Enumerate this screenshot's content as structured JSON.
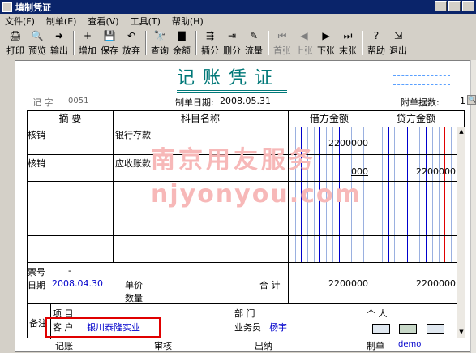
{
  "window": {
    "title": "填制凭证"
  },
  "menu": [
    {
      "label": "文件(F)"
    },
    {
      "label": "制单(E)"
    },
    {
      "label": "查看(V)"
    },
    {
      "label": "工具(T)"
    },
    {
      "label": "帮助(H)"
    }
  ],
  "toolbar": [
    {
      "label": "打印",
      "icon": "printer-icon",
      "glyph": "🖨",
      "enabled": true
    },
    {
      "label": "预览",
      "icon": "preview-icon",
      "glyph": "🔍",
      "enabled": true
    },
    {
      "label": "输出",
      "icon": "export-icon",
      "glyph": "➜",
      "enabled": true
    },
    {
      "label": "增加",
      "icon": "add-icon",
      "glyph": "+",
      "enabled": true
    },
    {
      "label": "保存",
      "icon": "save-icon",
      "glyph": "💾",
      "enabled": true
    },
    {
      "label": "放弃",
      "icon": "undo-icon",
      "glyph": "↶",
      "enabled": true
    },
    {
      "label": "查询",
      "icon": "binoculars-icon",
      "glyph": "🔭",
      "enabled": true
    },
    {
      "label": "余额",
      "icon": "balance-chart-icon",
      "glyph": "▇",
      "enabled": true
    },
    {
      "label": "插分",
      "icon": "insert-row-icon",
      "glyph": "⇶",
      "enabled": true
    },
    {
      "label": "删分",
      "icon": "delete-row-icon",
      "glyph": "⇥",
      "enabled": true
    },
    {
      "label": "流量",
      "icon": "cashflow-icon",
      "glyph": "✎",
      "enabled": true
    },
    {
      "label": "首张",
      "icon": "first-record-icon",
      "glyph": "⏮",
      "enabled": false
    },
    {
      "label": "上张",
      "icon": "previous-record-icon",
      "glyph": "◀",
      "enabled": false
    },
    {
      "label": "下张",
      "icon": "next-record-icon",
      "glyph": "▶",
      "enabled": true
    },
    {
      "label": "末张",
      "icon": "last-record-icon",
      "glyph": "⏭",
      "enabled": true
    },
    {
      "label": "帮助",
      "icon": "help-icon",
      "glyph": "?",
      "enabled": true
    },
    {
      "label": "退出",
      "icon": "exit-icon",
      "glyph": "⇲",
      "enabled": true
    }
  ],
  "voucher": {
    "title": "记账凭证",
    "type_label": "记 字",
    "number": "0051",
    "date_label": "制单日期:",
    "date": "2008.05.31",
    "attachments_label": "附单据数:",
    "attachments_value": "1"
  },
  "grid": {
    "headers": {
      "summary": "摘 要",
      "account": "科目名称",
      "debit": "借方金额",
      "credit": "贷方金额"
    },
    "rows": [
      {
        "summary": "核销",
        "account": "银行存款",
        "debit": "2200000",
        "credit": ""
      },
      {
        "summary": "核销",
        "account": "应收账款",
        "debit": "000",
        "credit": "2200000"
      },
      {
        "summary": "",
        "account": "",
        "debit": "",
        "credit": ""
      },
      {
        "summary": "",
        "account": "",
        "debit": "",
        "credit": ""
      },
      {
        "summary": "",
        "account": "",
        "debit": "",
        "credit": ""
      }
    ],
    "ticket_label": "票号",
    "ticket_value": "-",
    "date_label": "日期",
    "date_value": "2008.04.30",
    "price_label": "单价",
    "qty_label": "数量",
    "total_label": "合 计",
    "total_debit": "2200000",
    "total_credit": "2200000"
  },
  "notes": {
    "label": "备注",
    "project_label": "项 目",
    "customer_label": "客 户",
    "customer_value": "银川泰隆实业",
    "department_label": "部 门",
    "salesperson_label": "业务员",
    "salesperson_value": "杨宇",
    "person_label": "个 人"
  },
  "signatures": {
    "posting_label": "记账",
    "audit_label": "审核",
    "cashier_label": "出纳",
    "preparer_label": "制单",
    "preparer_value": "demo"
  },
  "watermark": {
    "line1": "南京用友服务",
    "line2": "njyonyou.com"
  },
  "colors": {
    "title": "#007878",
    "highlight": "#e00000",
    "value_blue": "#0000cc"
  }
}
